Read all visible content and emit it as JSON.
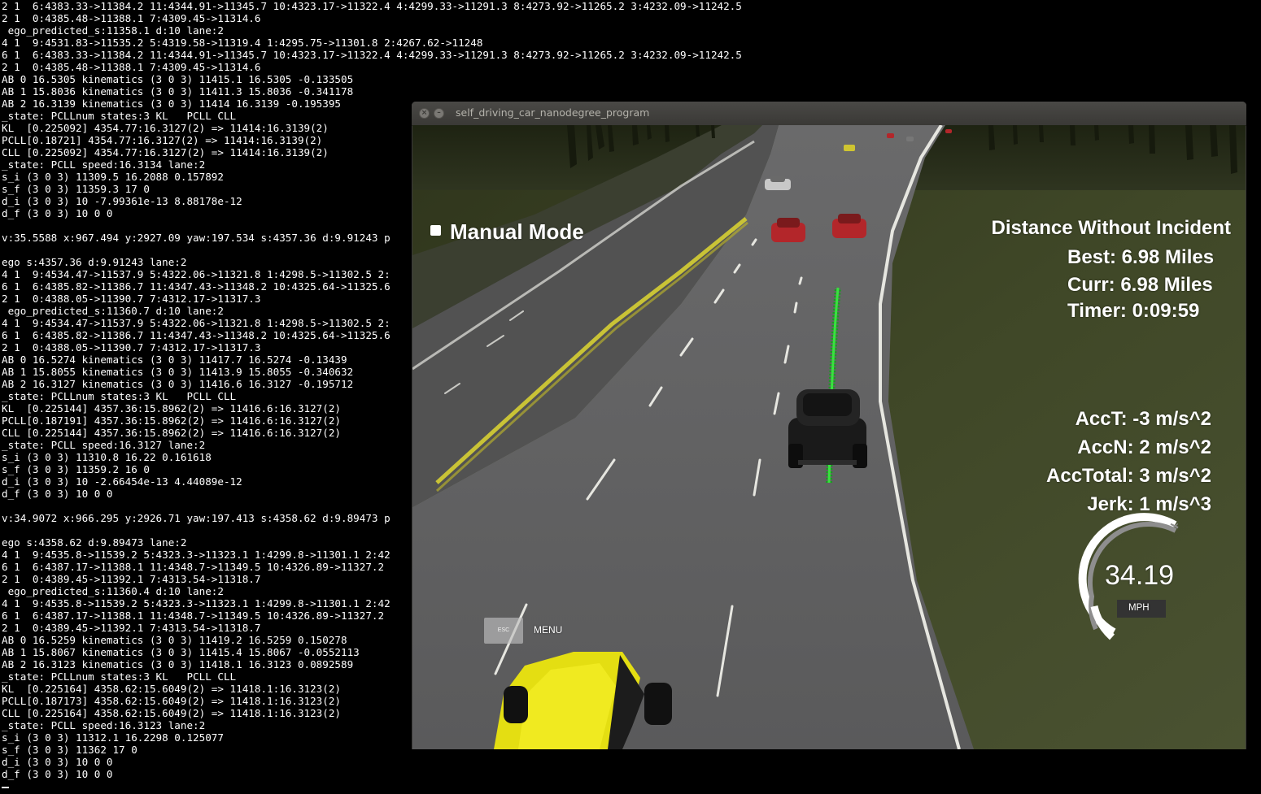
{
  "terminal": {
    "lines": [
      "2 1  6:4383.33->11384.2 11:4344.91->11345.7 10:4323.17->11322.4 4:4299.33->11291.3 8:4273.92->11265.2 3:4232.09->11242.5",
      "2 1  0:4385.48->11388.1 7:4309.45->11314.6",
      " ego_predicted_s:11358.1 d:10 lane:2",
      "4 1  9:4531.83->11535.2 5:4319.58->11319.4 1:4295.75->11301.8 2:4267.62->11248",
      "6 1  6:4383.33->11384.2 11:4344.91->11345.7 10:4323.17->11322.4 4:4299.33->11291.3 8:4273.92->11265.2 3:4232.09->11242.5",
      "2 1  0:4385.48->11388.1 7:4309.45->11314.6",
      "AB 0 16.5305 kinematics (3 0 3) 11415.1 16.5305 -0.133505",
      "AB 1 15.8036 kinematics (3 0 3) 11411.3 15.8036 -0.341178",
      "AB 2 16.3139 kinematics (3 0 3) 11414 16.3139 -0.195395",
      "_state: PCLLnum states:3 KL   PCLL CLL",
      "KL  [0.225092] 4354.77:16.3127(2) => 11414:16.3139(2)",
      "PCLL[0.18721] 4354.77:16.3127(2) => 11414:16.3139(2)",
      "CLL [0.225092] 4354.77:16.3127(2) => 11414:16.3139(2)",
      "_state: PCLL speed:16.3134 lane:2",
      "s_i (3 0 3) 11309.5 16.2088 0.157892",
      "s_f (3 0 3) 11359.3 17 0",
      "d_i (3 0 3) 10 -7.99361e-13 8.88178e-12",
      "d_f (3 0 3) 10 0 0",
      "",
      "v:35.5588 x:967.494 y:2927.09 yaw:197.534 s:4357.36 d:9.91243 p",
      "",
      "ego s:4357.36 d:9.91243 lane:2",
      "4 1  9:4534.47->11537.9 5:4322.06->11321.8 1:4298.5->11302.5 2:",
      "6 1  6:4385.82->11386.7 11:4347.43->11348.2 10:4325.64->11325.6",
      "2 1  0:4388.05->11390.7 7:4312.17->11317.3",
      " ego_predicted_s:11360.7 d:10 lane:2",
      "4 1  9:4534.47->11537.9 5:4322.06->11321.8 1:4298.5->11302.5 2:",
      "6 1  6:4385.82->11386.7 11:4347.43->11348.2 10:4325.64->11325.6",
      "2 1  0:4388.05->11390.7 7:4312.17->11317.3",
      "AB 0 16.5274 kinematics (3 0 3) 11417.7 16.5274 -0.13439",
      "AB 1 15.8055 kinematics (3 0 3) 11413.9 15.8055 -0.340632",
      "AB 2 16.3127 kinematics (3 0 3) 11416.6 16.3127 -0.195712",
      "_state: PCLLnum states:3 KL   PCLL CLL",
      "KL  [0.225144] 4357.36:15.8962(2) => 11416.6:16.3127(2)",
      "PCLL[0.187191] 4357.36:15.8962(2) => 11416.6:16.3127(2)",
      "CLL [0.225144] 4357.36:15.8962(2) => 11416.6:16.3127(2)",
      "_state: PCLL speed:16.3127 lane:2",
      "s_i (3 0 3) 11310.8 16.22 0.161618",
      "s_f (3 0 3) 11359.2 16 0",
      "d_i (3 0 3) 10 -2.66454e-13 4.44089e-12",
      "d_f (3 0 3) 10 0 0",
      "",
      "v:34.9072 x:966.295 y:2926.71 yaw:197.413 s:4358.62 d:9.89473 p",
      "",
      "ego s:4358.62 d:9.89473 lane:2",
      "4 1  9:4535.8->11539.2 5:4323.3->11323.1 1:4299.8->11301.1 2:42",
      "6 1  6:4387.17->11388.1 11:4348.7->11349.5 10:4326.89->11327.2",
      "2 1  0:4389.45->11392.1 7:4313.54->11318.7",
      " ego_predicted_s:11360.4 d:10 lane:2",
      "4 1  9:4535.8->11539.2 5:4323.3->11323.1 1:4299.8->11301.1 2:42",
      "6 1  6:4387.17->11388.1 11:4348.7->11349.5 10:4326.89->11327.2",
      "2 1  0:4389.45->11392.1 7:4313.54->11318.7",
      "AB 0 16.5259 kinematics (3 0 3) 11419.2 16.5259 0.150278",
      "AB 1 15.8067 kinematics (3 0 3) 11415.4 15.8067 -0.0552113",
      "AB 2 16.3123 kinematics (3 0 3) 11418.1 16.3123 0.0892589",
      "_state: PCLLnum states:3 KL   PCLL CLL",
      "KL  [0.225164] 4358.62:15.6049(2) => 11418.1:16.3123(2)",
      "PCLL[0.187173] 4358.62:15.6049(2) => 11418.1:16.3123(2)",
      "CLL [0.225164] 4358.62:15.6049(2) => 11418.1:16.3123(2)",
      "_state: PCLL speed:16.3123 lane:2",
      "s_i (3 0 3) 11312.1 16.2298 0.125077",
      "s_f (3 0 3) 11362 17 0",
      "d_i (3 0 3) 10 0 0",
      "d_f (3 0 3) 10 0 0"
    ]
  },
  "window": {
    "title": "self_driving_car_nanodegree_program"
  },
  "hud": {
    "mode_label": "Manual Mode",
    "distance_title": "Distance Without Incident",
    "best": "Best: 6.98 Miles",
    "curr": "Curr: 6.98 Miles",
    "timer": "Timer: 0:09:59",
    "acc_t": "AccT: -3 m/s^2",
    "acc_n": "AccN: 2 m/s^2",
    "acc_total": "AccTotal: 3 m/s^2",
    "jerk": "Jerk: 1 m/s^3",
    "speed": "34.19",
    "speed_unit": "MPH",
    "esc_label": "ESC",
    "menu_label": "MENU"
  },
  "colors": {
    "terminal_bg": "#000000",
    "terminal_text": "#ffffff",
    "road": "#5e5e5f",
    "grass": "#3d4426",
    "yellow_line": "#c9c336",
    "trajectory": "#22cc2a",
    "ego_car": "#1c1c1c",
    "yellow_car": "#e8e010",
    "red_car": "#c2262a"
  }
}
